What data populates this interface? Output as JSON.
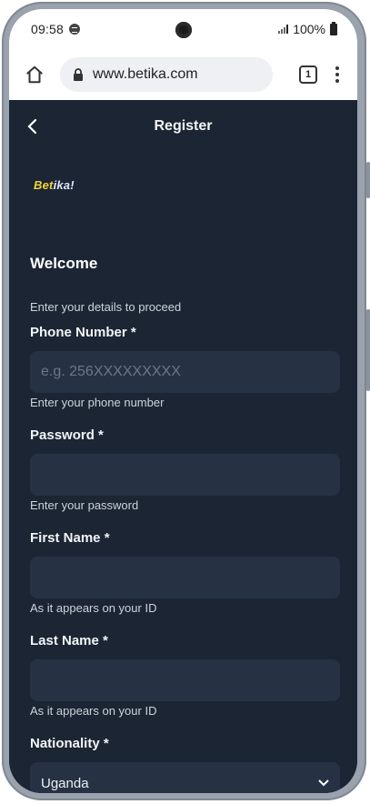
{
  "status_bar": {
    "time": "09:58",
    "battery": "100%"
  },
  "browser": {
    "url": "www.betika.com",
    "tab_count": "1"
  },
  "app": {
    "title": "Register",
    "logo_text_1": "Bet",
    "logo_text_2": "ika!",
    "welcome": "Welcome",
    "subtitle": "Enter your details to proceed",
    "fields": {
      "phone": {
        "label": "Phone Number *",
        "placeholder": "e.g. 256XXXXXXXXX",
        "helper": "Enter your phone number"
      },
      "password": {
        "label": "Password *",
        "helper": "Enter your password"
      },
      "first_name": {
        "label": "First Name *",
        "helper": "As it appears on your ID"
      },
      "last_name": {
        "label": "Last Name *",
        "helper": "As it appears on your ID"
      },
      "nationality": {
        "label": "Nationality *",
        "value": "Uganda"
      }
    }
  },
  "colors": {
    "background": "#1b2533",
    "input_bg": "#263244",
    "logo_yellow": "#f5d23b"
  }
}
